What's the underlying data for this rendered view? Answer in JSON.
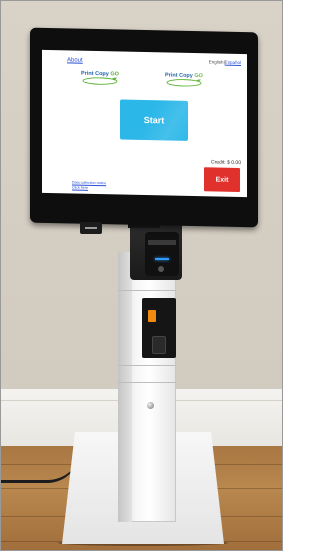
{
  "kiosk_screen": {
    "about_label": "About",
    "language": {
      "english": "English",
      "separator": "|",
      "espanol": "Español"
    },
    "logo_left": {
      "print_copy": "Print Copy",
      "go": "GO"
    },
    "logo_right": {
      "print_copy": "Print Copy",
      "go": "GO"
    },
    "start_label": "Start",
    "credit_text": "Credit: $ 0.00",
    "exit_label": "Exit",
    "footer_link_1": "Data collection notice",
    "footer_link_2": "Click here"
  },
  "colors": {
    "start_button": "#2bb7e8",
    "exit_button": "#e0312c",
    "logo_blue": "#1d5fa8",
    "logo_green": "#58b12f",
    "link_blue": "#2a4fd6",
    "bill_led": "#2f9bff",
    "coin_slot": "#f28b10"
  }
}
